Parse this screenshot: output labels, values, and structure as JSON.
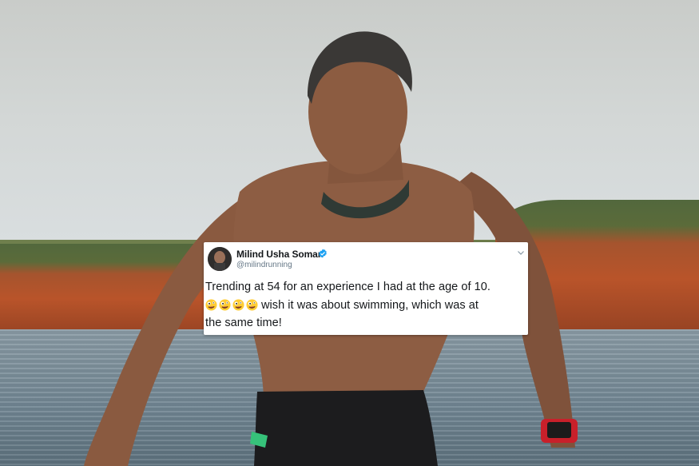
{
  "tweet": {
    "name": "Milind Usha Soman",
    "handle": "@milindrunning",
    "line1": "Trending at 54 for an experience I had at the age of 10.",
    "line2": "wish it was about swimming, which was at",
    "line3": "the same time!",
    "emoji_count": 4,
    "emoji_icon": "zany-face-icon"
  },
  "colors": {
    "verified": "#1da1f2",
    "text": "#14171a",
    "secondary": "#657786"
  }
}
